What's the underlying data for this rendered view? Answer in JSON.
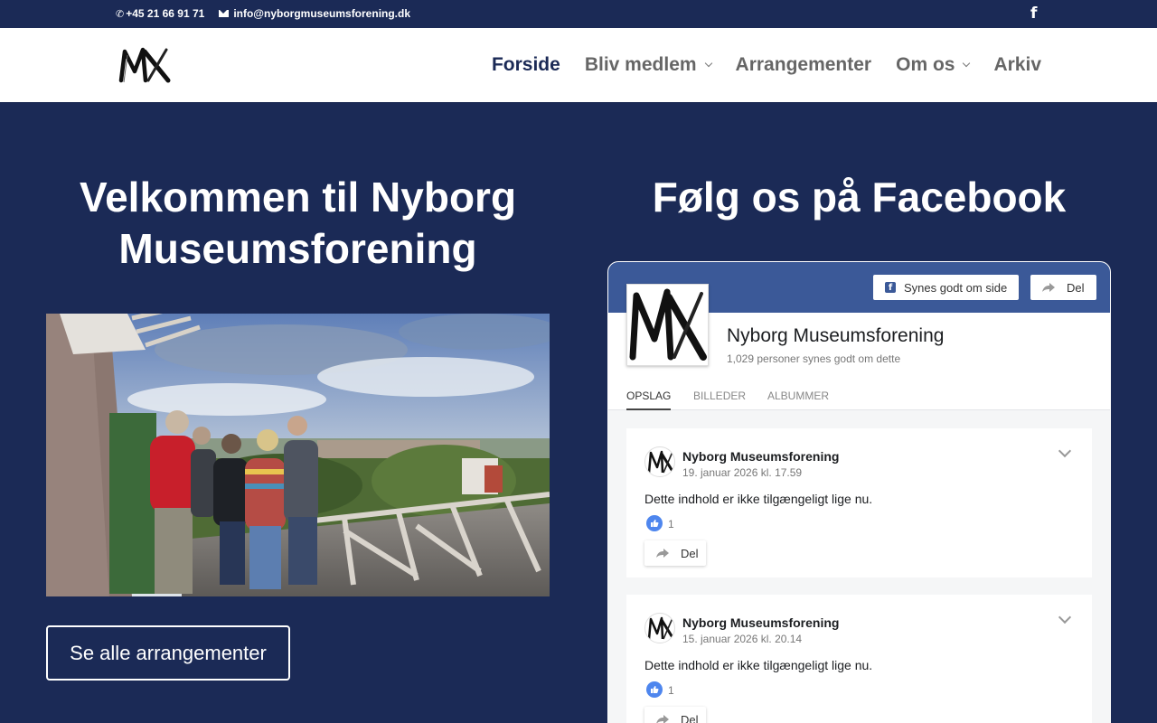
{
  "topbar": {
    "phone": "+45 21 66 91 71",
    "email": "info@nyborgmuseumsforening.dk",
    "icons": [
      "phone-icon",
      "mail-icon",
      "facebook-icon"
    ]
  },
  "header": {
    "logo": "MX",
    "nav": [
      {
        "label": "Forside",
        "active": true,
        "dropdown": false
      },
      {
        "label": "Bliv medlem",
        "active": false,
        "dropdown": true
      },
      {
        "label": "Arrangementer",
        "active": false,
        "dropdown": false
      },
      {
        "label": "Om os",
        "active": false,
        "dropdown": true
      },
      {
        "label": "Arkiv",
        "active": false,
        "dropdown": false
      }
    ]
  },
  "main": {
    "welcome_line1": "Velkommen til Nyborg",
    "welcome_line2": "Museumsforening",
    "cta_label": "Se alle arrangementer",
    "facebook_title": "Følg os på Facebook"
  },
  "fb": {
    "like_label": "Synes godt om side",
    "share_label": "Del",
    "page_name": "Nyborg Museumsforening",
    "likes_text": "1,029 personer synes godt om dette",
    "tabs": [
      "OPSLAG",
      "BILLEDER",
      "ALBUMMER"
    ],
    "posts": [
      {
        "author": "Nyborg Museumsforening",
        "date": "19. januar 2026 kl. 17.59",
        "text": "Dette indhold er ikke tilgængeligt lige nu.",
        "likes": "1",
        "share": "Del"
      },
      {
        "author": "Nyborg Museumsforening",
        "date": "15. januar 2026 kl. 20.14",
        "text": "Dette indhold er ikke tilgængeligt lige nu.",
        "likes": "1",
        "share": "Del"
      }
    ]
  },
  "colors": {
    "navy": "#1b2a56",
    "facebook_blue": "#3b5998",
    "like_blue": "#4e86ee",
    "nav_gray": "#666666"
  }
}
